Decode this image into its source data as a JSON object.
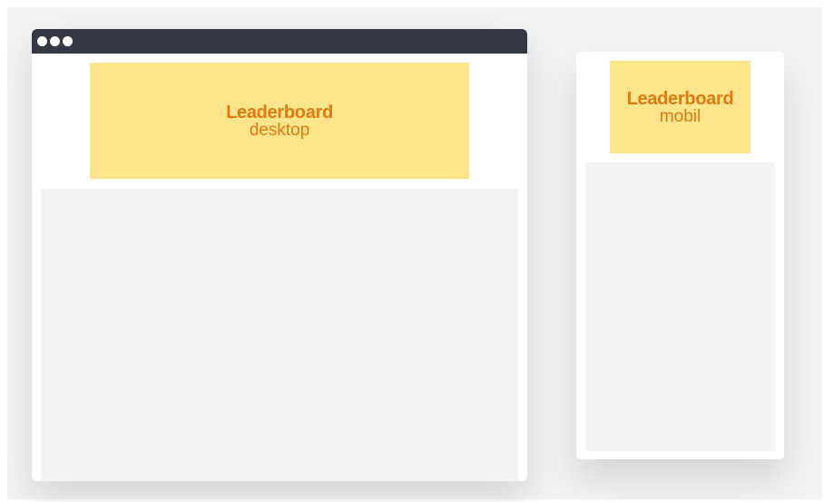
{
  "desktop": {
    "ad": {
      "title": "Leaderboard",
      "subtitle": "desktop"
    }
  },
  "mobile": {
    "ad": {
      "title": "Leaderboard",
      "subtitle": "mobil"
    }
  },
  "colors": {
    "ad_background": "#fde58b",
    "ad_text": "#e07a10",
    "titlebar": "#343744",
    "content_placeholder": "#f2f3f5"
  }
}
